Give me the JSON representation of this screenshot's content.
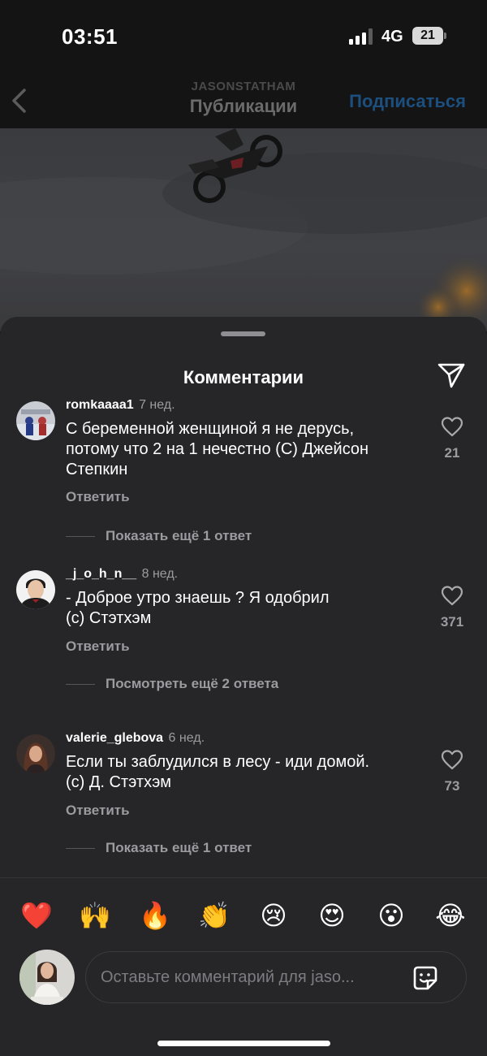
{
  "status_bar": {
    "time": "03:51",
    "network": "4G",
    "battery": "21",
    "icons": [
      "signal-icon",
      "battery-icon"
    ]
  },
  "header": {
    "account": "JASONSTATHAM",
    "title": "Публикации",
    "follow_label": "Подписаться",
    "icons": [
      "back-icon"
    ]
  },
  "sheet": {
    "title": "Комментарии",
    "icons": [
      "share-icon"
    ]
  },
  "comments": [
    {
      "username": "romkaaaa1",
      "time": "7 нед.",
      "text": "С беременной женщиной я не дерусь,\nпотому что 2 на 1 нечестно (С) Джейсон\nСтепкин",
      "likes": "21",
      "reply_label": "Ответить",
      "more_label": "Показать ещё 1 ответ"
    },
    {
      "username": "_j_o_h_n__",
      "time": "8 нед.",
      "text": "- Доброе утро знаешь ? Я одобрил\n (с) Стэтхэм",
      "likes": "371",
      "reply_label": "Ответить",
      "more_label": "Посмотреть ещё 2 ответа"
    },
    {
      "username": "valerie_glebova",
      "time": "6 нед.",
      "text": "Если ты заблудился в лесу - иди домой.\n(с) Д. Стэтхэм",
      "likes": "73",
      "reply_label": "Ответить",
      "more_label": "Показать ещё 1 ответ"
    }
  ],
  "reactions": [
    "❤️",
    "🙌",
    "🔥",
    "👏",
    "😢",
    "😍",
    "😮",
    "😂"
  ],
  "composer": {
    "placeholder": "Оставьте комментарий для jaso...",
    "icons": [
      "sticker-icon"
    ]
  },
  "colors": {
    "sheet_bg": "#262629",
    "muted_text": "#9b9ba0",
    "follow_blue": "#1d4f7e"
  }
}
